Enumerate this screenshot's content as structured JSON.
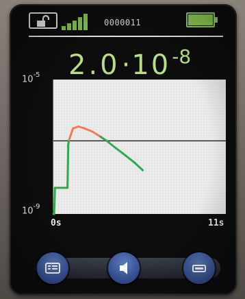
{
  "status": {
    "lock": "unlocked-padlock-icon",
    "signal_bars": 5,
    "device_id": "0000011",
    "battery": "battery-full-icon",
    "battery_level": 1.0
  },
  "readout": {
    "mantissa": "2.0",
    "base": "10",
    "exponent": "-8"
  },
  "colors": {
    "readout": "#b7dd86",
    "trace_normal": "#2fa84f",
    "trace_alarm": "#ef7b5a",
    "threshold": "#2a2a2a",
    "plot_bg": "#ebebeb",
    "button": "#3a569a"
  },
  "chart_data": {
    "type": "line",
    "title": "",
    "xlabel": "",
    "ylabel": "",
    "scale_y": "log",
    "ylim_label_top_base": "10",
    "ylim_label_top_exp": "-5",
    "ylim_label_bottom_base": "10",
    "ylim_label_bottom_exp": "-9",
    "ylim": [
      1e-09,
      1e-05
    ],
    "xlim": [
      0,
      11
    ],
    "x_tick_labels": [
      "0s",
      "11s"
    ],
    "threshold": 1.5e-07,
    "grid": true,
    "series": [
      {
        "points": [
          [
            0.0,
            1e-09
          ],
          [
            0.05,
            1e-09
          ],
          [
            0.1,
            6e-09
          ],
          [
            0.9,
            6e-09
          ],
          [
            0.95,
            1.2e-07
          ],
          [
            1.0,
            1.6e-07
          ],
          [
            1.25,
            3.5e-07
          ],
          [
            1.6,
            4e-07
          ],
          [
            2.0,
            3.5e-07
          ],
          [
            2.5,
            2.8e-07
          ],
          [
            3.0,
            2e-07
          ],
          [
            3.4,
            1.5e-07
          ],
          [
            4.0,
            9e-08
          ],
          [
            4.6,
            5.5e-08
          ],
          [
            5.2,
            3.3e-08
          ],
          [
            5.7,
            2e-08
          ]
        ]
      }
    ]
  },
  "buttons": [
    {
      "name": "menu-list-icon"
    },
    {
      "name": "speaker-mute-icon"
    },
    {
      "name": "display-toggle-icon"
    }
  ]
}
